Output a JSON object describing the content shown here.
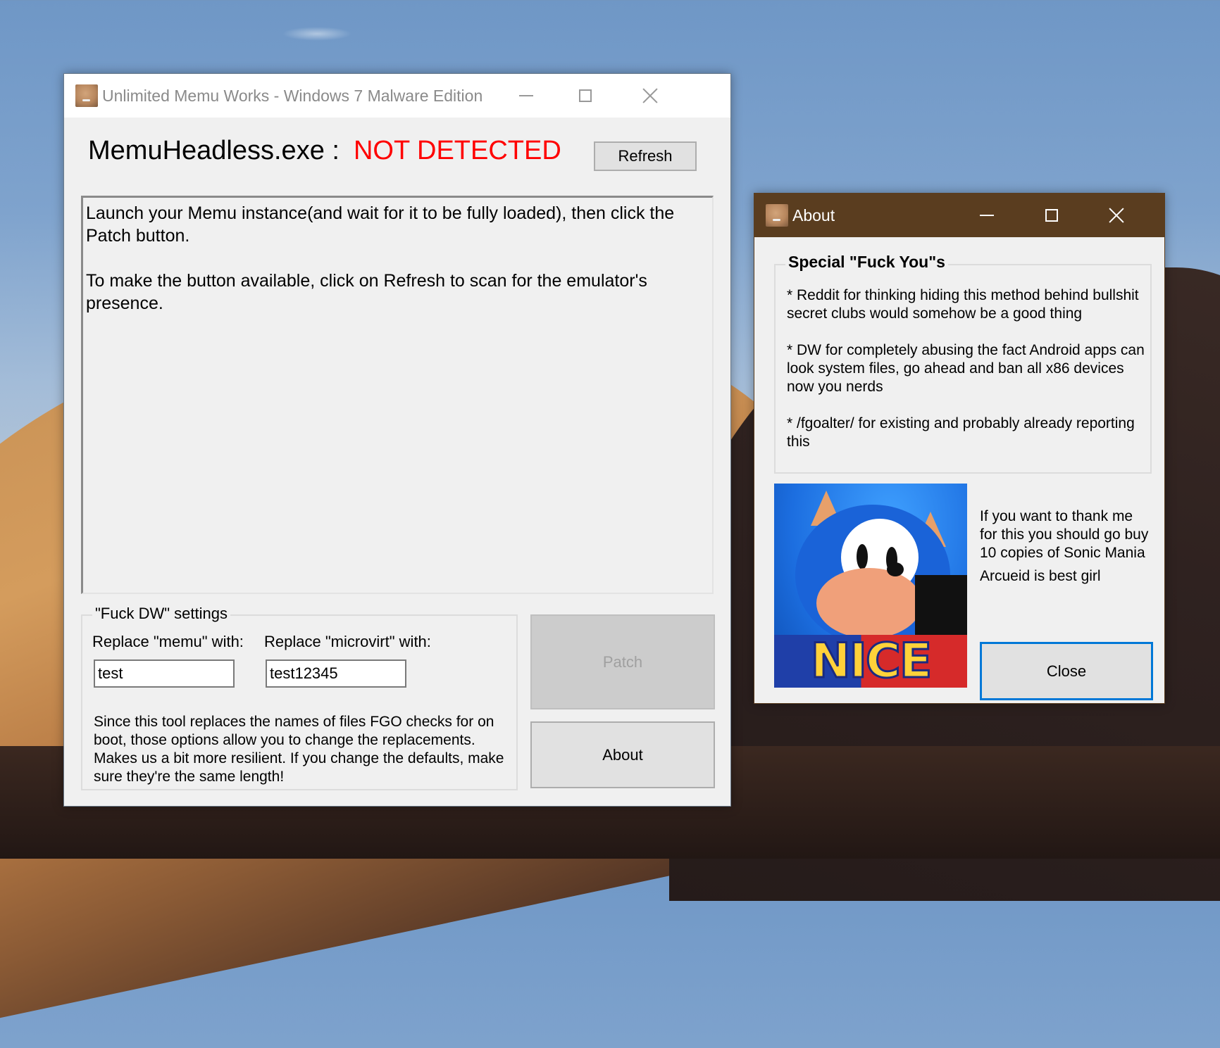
{
  "desktop": {
    "wallpaper": "desert-dunes"
  },
  "main_window": {
    "title": "Unlimited Memu Works - Windows 7 Malware Edition",
    "icon": "app-avatar-icon",
    "controls": {
      "minimize": "minimize-icon",
      "maximize": "maximize-icon",
      "close": "close-icon"
    },
    "status": {
      "label": "MemuHeadless.exe :",
      "value": "NOT DETECTED",
      "value_color": "#ff0000"
    },
    "refresh_label": "Refresh",
    "instructions": "Launch your Memu instance(and wait for it to be fully loaded), then click the Patch button.\n\nTo make the button available, click on Refresh to scan for the emulator's presence.",
    "settings": {
      "legend": "\"Fuck DW\" settings",
      "memu_label": "Replace \"memu\" with:",
      "memu_value": "test",
      "microvirt_label": "Replace \"microvirt\" with:",
      "microvirt_value": "test12345",
      "note": "Since this tool replaces the names of files FGO checks for on boot, those options allow you to change the replacements. Makes us a bit more resilient. If you change the defaults, make sure they're the same length!"
    },
    "patch_label": "Patch",
    "patch_enabled": false,
    "about_label": "About"
  },
  "about_window": {
    "title": "About",
    "titlebar_color": "#5a3d1f",
    "thanks": {
      "legend": "Special \"Fuck You\"s",
      "items": [
        "* Reddit for thinking hiding this method behind bullshit secret clubs would somehow be a good thing",
        "* DW for completely abusing the fact Android apps can look system files, go ahead and ban all x86 devices now you nerds",
        "* /fgoalter/ for existing and probably already reporting this"
      ]
    },
    "image_caption": "NICE",
    "message": "If you want to thank me for this you should go buy 10 copies of Sonic Mania",
    "footer": "Arcueid is best girl",
    "close_label": "Close",
    "close_focus_color": "#0078d7"
  }
}
